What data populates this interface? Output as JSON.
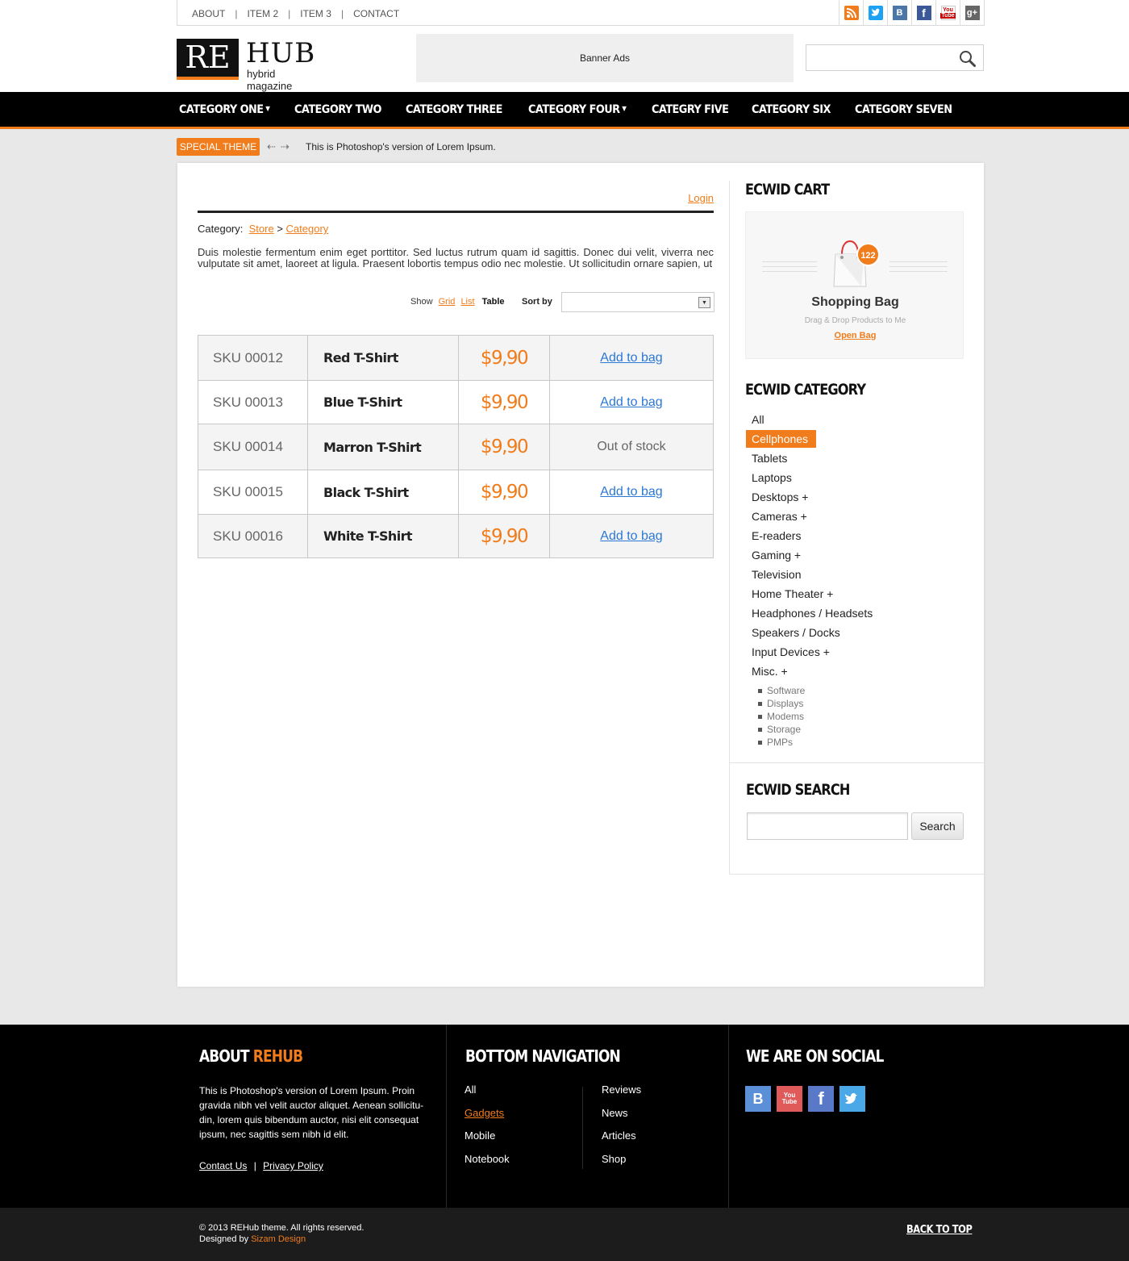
{
  "top_links": [
    "ABOUT",
    "ITEM 2",
    "ITEM 3",
    "CONTACT"
  ],
  "top_social_icons": [
    "rss-icon",
    "twitter-icon",
    "vk-icon",
    "facebook-icon",
    "youtube-icon",
    "google-plus-icon"
  ],
  "logo": {
    "mark": "RE",
    "name": "HUB",
    "tagline": "hybrid magazine"
  },
  "banner": "Banner Ads",
  "nav": [
    {
      "label": "CATEGORY ONE",
      "has_dropdown": true
    },
    {
      "label": "CATEGORY TWO",
      "has_dropdown": false
    },
    {
      "label": "CATEGORY THREE",
      "has_dropdown": false
    },
    {
      "label": "CATEGORY FOUR",
      "has_dropdown": true
    },
    {
      "label": "CATEGRY FIVE",
      "has_dropdown": false
    },
    {
      "label": "CATEGORY SIX",
      "has_dropdown": false
    },
    {
      "label": "CATEGORY SEVEN",
      "has_dropdown": false
    }
  ],
  "ticker": {
    "badge": "SPECIAL THEME",
    "text": "This is Photoshop's version  of Lorem Ipsum."
  },
  "store": {
    "login": "Login",
    "crumb_label": "Category:",
    "crumb_store": "Store",
    "crumb_sep": ">",
    "crumb_category": "Category",
    "description": "Duis molestie fermentum enim eget porttitor. Sed luctus rutrum quam id sagittis. Donec dui velit, viverra nec vulputate sit amet, laoreet at ligula. Praesent lobortis tempus odio nec molestie. Ut sollicitudin ornare sapien, ut",
    "show_label": "Show",
    "view_grid": "Grid",
    "view_list": "List",
    "view_table": "Table",
    "sort_label": "Sort by",
    "sort_value": ""
  },
  "products": [
    {
      "sku": "SKU 00012",
      "name": "Red T-Shirt",
      "price": "$9,90",
      "action": "Add to bag",
      "in_stock": true
    },
    {
      "sku": "SKU 00013",
      "name": "Blue T-Shirt",
      "price": "$9,90",
      "action": "Add to bag",
      "in_stock": true
    },
    {
      "sku": "SKU 00014",
      "name": "Marron T-Shirt",
      "price": "$9,90",
      "action": "Out of stock",
      "in_stock": false
    },
    {
      "sku": "SKU 00015",
      "name": "Black T-Shirt",
      "price": "$9,90",
      "action": "Add to bag",
      "in_stock": true
    },
    {
      "sku": "SKU 00016",
      "name": "White T-Shirt",
      "price": "$9,90",
      "action": "Add to bag",
      "in_stock": true
    }
  ],
  "cart": {
    "heading": "ECWID CART",
    "count": "122",
    "title": "Shopping Bag",
    "subtitle": "Drag & Drop Products to Me",
    "open_link": "Open Bag"
  },
  "categories": {
    "heading": "ECWID CATEGORY",
    "items": [
      "All",
      "Cellphones",
      "Tablets",
      "Laptops",
      "Desktops +",
      "Cameras +",
      "E-readers",
      "Gaming +",
      "Television",
      "Home Theater +",
      "Headphones / Headsets",
      "Speakers / Docks",
      "Input Devices +",
      "Misc. +"
    ],
    "active": "Cellphones",
    "sub_items": [
      "Software",
      "Displays",
      "Modems",
      "Storage",
      "PMPs"
    ]
  },
  "search": {
    "heading": "ECWID SEARCH",
    "value": "",
    "button": "Search"
  },
  "footer": {
    "about_heading_1": "ABOUT ",
    "about_heading_2": "REHUB",
    "about_text": "This is Photoshop's version  of Lorem Ipsum. Proin gravida nibh vel velit auctor aliquet. Aenean sollicitu-din, lorem quis bibendum auctor, nisi elit consequat ipsum, nec sagittis sem nibh id elit.",
    "contact_link": "Contact Us",
    "link_sep": "|",
    "privacy_link": "Privacy Policy",
    "nav_heading": "BOTTOM NAVIGATION",
    "nav_col1": [
      "All",
      "Gadgets",
      "Mobile",
      "Notebook"
    ],
    "nav_col2": [
      "Reviews",
      "News",
      "Articles",
      "Shop"
    ],
    "nav_active": "Gadgets",
    "social_heading": "WE ARE ON SOCIAL",
    "social_icons": [
      "vk-icon",
      "youtube-icon",
      "facebook-icon",
      "twitter-icon"
    ]
  },
  "bottom": {
    "copyright": "© 2013 REHub theme. All rights reserved.",
    "designed_by": "Designed by ",
    "designer": "Sizam Design",
    "back_to_top": "BACK TO TOP"
  },
  "colors": {
    "accent": "#f07c1b",
    "link_blue": "#2b78d4",
    "nav_bg": "#000000",
    "footer_bg": "#000000"
  }
}
